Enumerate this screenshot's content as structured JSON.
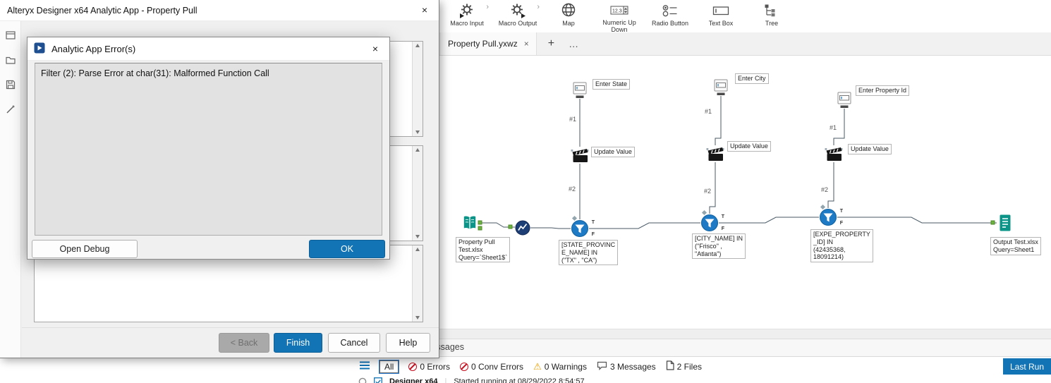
{
  "colors": {
    "accent_blue": "#1273b5",
    "teal": "#0d9488",
    "filter_blue": "#1e7ac4",
    "browse_navy": "#1d3f76",
    "error_red": "#c50f1f",
    "warning_orange": "#e8a000",
    "anchor_green": "#6cb33f"
  },
  "dialog": {
    "title": "Alteryx Designer x64 Analytic App - Property Pull",
    "close": "×",
    "buttons": {
      "back": "< Back",
      "finish": "Finish",
      "cancel": "Cancel",
      "help": "Help"
    }
  },
  "error_dialog": {
    "title": "Analytic App Error(s)",
    "close": "×",
    "message": "Filter (2): Parse Error at char(31): Malformed Function Call",
    "buttons": {
      "open_debug": "Open Debug",
      "ok": "OK"
    }
  },
  "palette": {
    "items": [
      {
        "label": "Macro Input"
      },
      {
        "label": "Macro Output"
      },
      {
        "label": "Map"
      },
      {
        "label": "Numeric Up Down"
      },
      {
        "label": "Radio Button"
      },
      {
        "label": "Text Box"
      },
      {
        "label": "Tree"
      }
    ]
  },
  "tab_bar": {
    "active_tab": "Property Pull.yxwz",
    "close": "×",
    "new_tab": "+",
    "more": "…"
  },
  "canvas": {
    "chains": [
      {
        "caption": "Enter State",
        "in_label": "#1",
        "out_label": "#2",
        "action": "Update Value"
      },
      {
        "caption": "Enter City",
        "in_label": "#1",
        "out_label": "#2",
        "action": "Update Value"
      },
      {
        "caption": "Enter Property Id",
        "in_label": "#1",
        "out_label": "#2",
        "action": "Update Value"
      }
    ],
    "input_annotation": "Property Pull\nTest.xlsx\nQuery=`Sheet1$`",
    "filter_annotations": [
      "[STATE_PROVINC\nE_NAME] IN\n(\"TX\" , \"CA\")",
      "[CITY_NAME] IN\n(\"Frisco\" ,\n\"Atlanta\")",
      "[EXPE_PROPERTY\n_ID] IN\n(42435368,\n18091214)"
    ],
    "output_annotation": "Output Test.xlsx\nQuery=Sheet1",
    "filter_true": "T",
    "filter_false": "F"
  },
  "messages_panel": {
    "title": "Messages"
  },
  "status_bar": {
    "filter_all": "All",
    "errors": "0 Errors",
    "conv_errors": "0 Conv Errors",
    "warnings": "0 Warnings",
    "messages": "3 Messages",
    "files": "2 Files",
    "last_run": "Last Run"
  },
  "run_row": {
    "app": "Designer x64",
    "status": "Started running at 08/29/2022 8:54:57"
  }
}
